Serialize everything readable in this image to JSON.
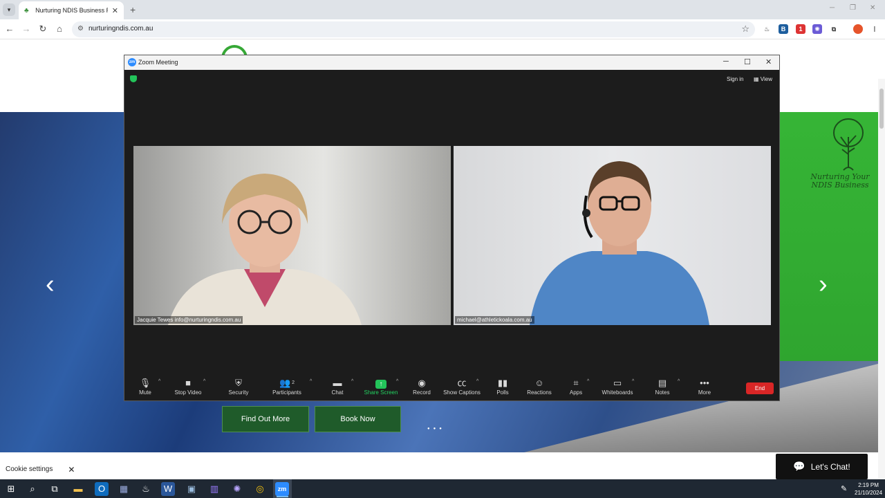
{
  "browser": {
    "tab_title": "Nurturing NDIS Business Regist",
    "tab_close": "✕",
    "new_tab": "+",
    "url": "nurturingndis.com.au",
    "star": "☆"
  },
  "site": {
    "brand_lines": [
      "Nurturing Your",
      "NDIS Business"
    ],
    "buttons": {
      "find_out_more": "Find Out More",
      "book_now": "Book Now"
    },
    "cookie_label": "Cookie settings",
    "cookie_close": "✕",
    "chat_label": "Let's Chat!",
    "prev_arrow": "‹",
    "next_arrow": "›"
  },
  "zoom": {
    "window_title": "Zoom Meeting",
    "logo_text": "zm",
    "sign_in": "Sign in",
    "view": "View",
    "participants": [
      {
        "name": "Jacquie Tewes info@nurturingndis.com.au"
      },
      {
        "name": "michael@athletickoala.com.au"
      }
    ],
    "controls": {
      "mute": "Mute",
      "stop_video": "Stop Video",
      "security": "Security",
      "participants": "Participants",
      "participants_count": "2",
      "chat": "Chat",
      "share_screen": "Share Screen",
      "record": "Record",
      "show_captions": "Show Captions",
      "polls": "Polls",
      "reactions": "Reactions",
      "apps": "Apps",
      "whiteboards": "Whiteboards",
      "notes": "Notes",
      "more": "More",
      "end": "End"
    },
    "colors": {
      "share_green": "#23c45a",
      "end_red": "#d92626"
    }
  },
  "taskbar": {
    "time": "2:19 PM",
    "date": "21/10/2024"
  }
}
